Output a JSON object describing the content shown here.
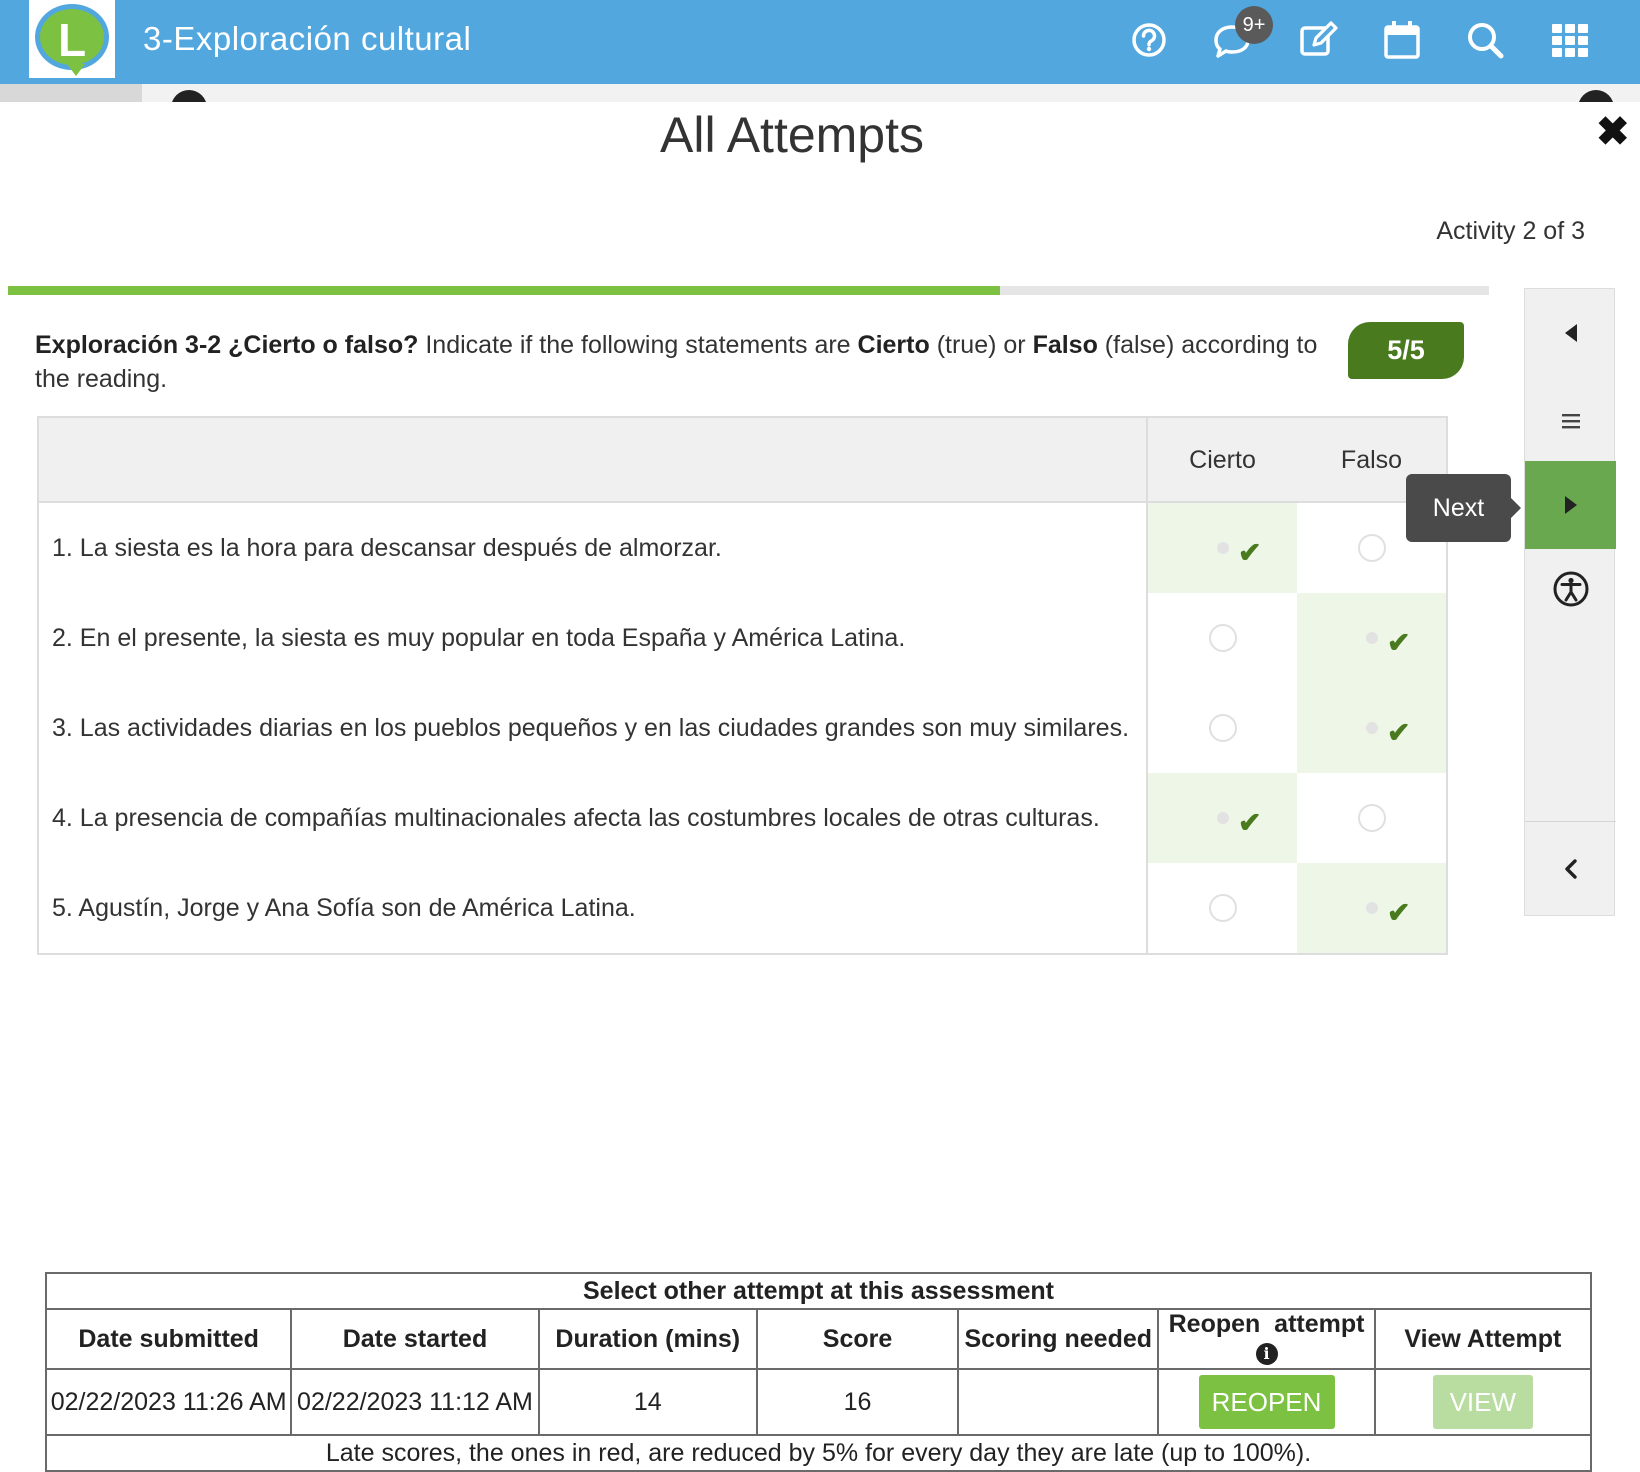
{
  "app": {
    "title": "3-Exploración cultural",
    "logo_letter": "L",
    "accent": "#52a7de",
    "brand_green": "#7cc142"
  },
  "topbar": {
    "icons": [
      "help-icon",
      "chat-icon",
      "edit-icon",
      "calendar-icon",
      "search-icon",
      "apps-grid-icon"
    ],
    "notifications_badge": "9+"
  },
  "modal": {
    "title": "All Attempts",
    "activity_counter": "Activity 2 of 3",
    "progress": 0.67
  },
  "question": {
    "title_bold": "Exploración 3-2 ¿Cierto o falso?",
    "text_1": " Indicate if the following statements are ",
    "cierto_bold": "Cierto",
    "text_2": " (true) or ",
    "falso_bold": "Falso",
    "text_3": " (false) according to the reading.",
    "score": "5/5"
  },
  "table": {
    "columns": [
      "Cierto",
      "Falso"
    ],
    "rows": [
      {
        "statement": "1. La siesta es la hora para descansar después de almorzar.",
        "answer": "Cierto"
      },
      {
        "statement": "2. En el presente, la siesta es muy popular en toda España y América Latina.",
        "answer": "Falso"
      },
      {
        "statement": "3. Las actividades diarias en los pueblos pequeños y en las ciudades grandes son muy similares.",
        "answer": "Falso"
      },
      {
        "statement": "4. La presencia de compañías multinacionales afecta las costumbres locales de otras culturas.",
        "answer": "Cierto"
      },
      {
        "statement": "5. Agustín, Jorge y Ana Sofía son de América Latina.",
        "answer": "Falso"
      }
    ]
  },
  "sidenav": {
    "tooltip": "Next"
  },
  "attempts": {
    "caption": "Select other attempt at this assessment",
    "headers": [
      "Date submitted",
      "Date started",
      "Duration (mins)",
      "Score",
      "Scoring needed",
      "Reopen  attempt",
      "View Attempt"
    ],
    "row": {
      "date_submitted": "02/22/2023 11:26 AM",
      "date_started": "02/22/2023 11:12 AM",
      "duration": "14",
      "score": "16",
      "scoring_needed": "",
      "reopen_label": "REOPEN",
      "view_label": "VIEW"
    },
    "note": "Late scores, the ones in red, are reduced by 5% for every day they are late (up to 100%)."
  }
}
